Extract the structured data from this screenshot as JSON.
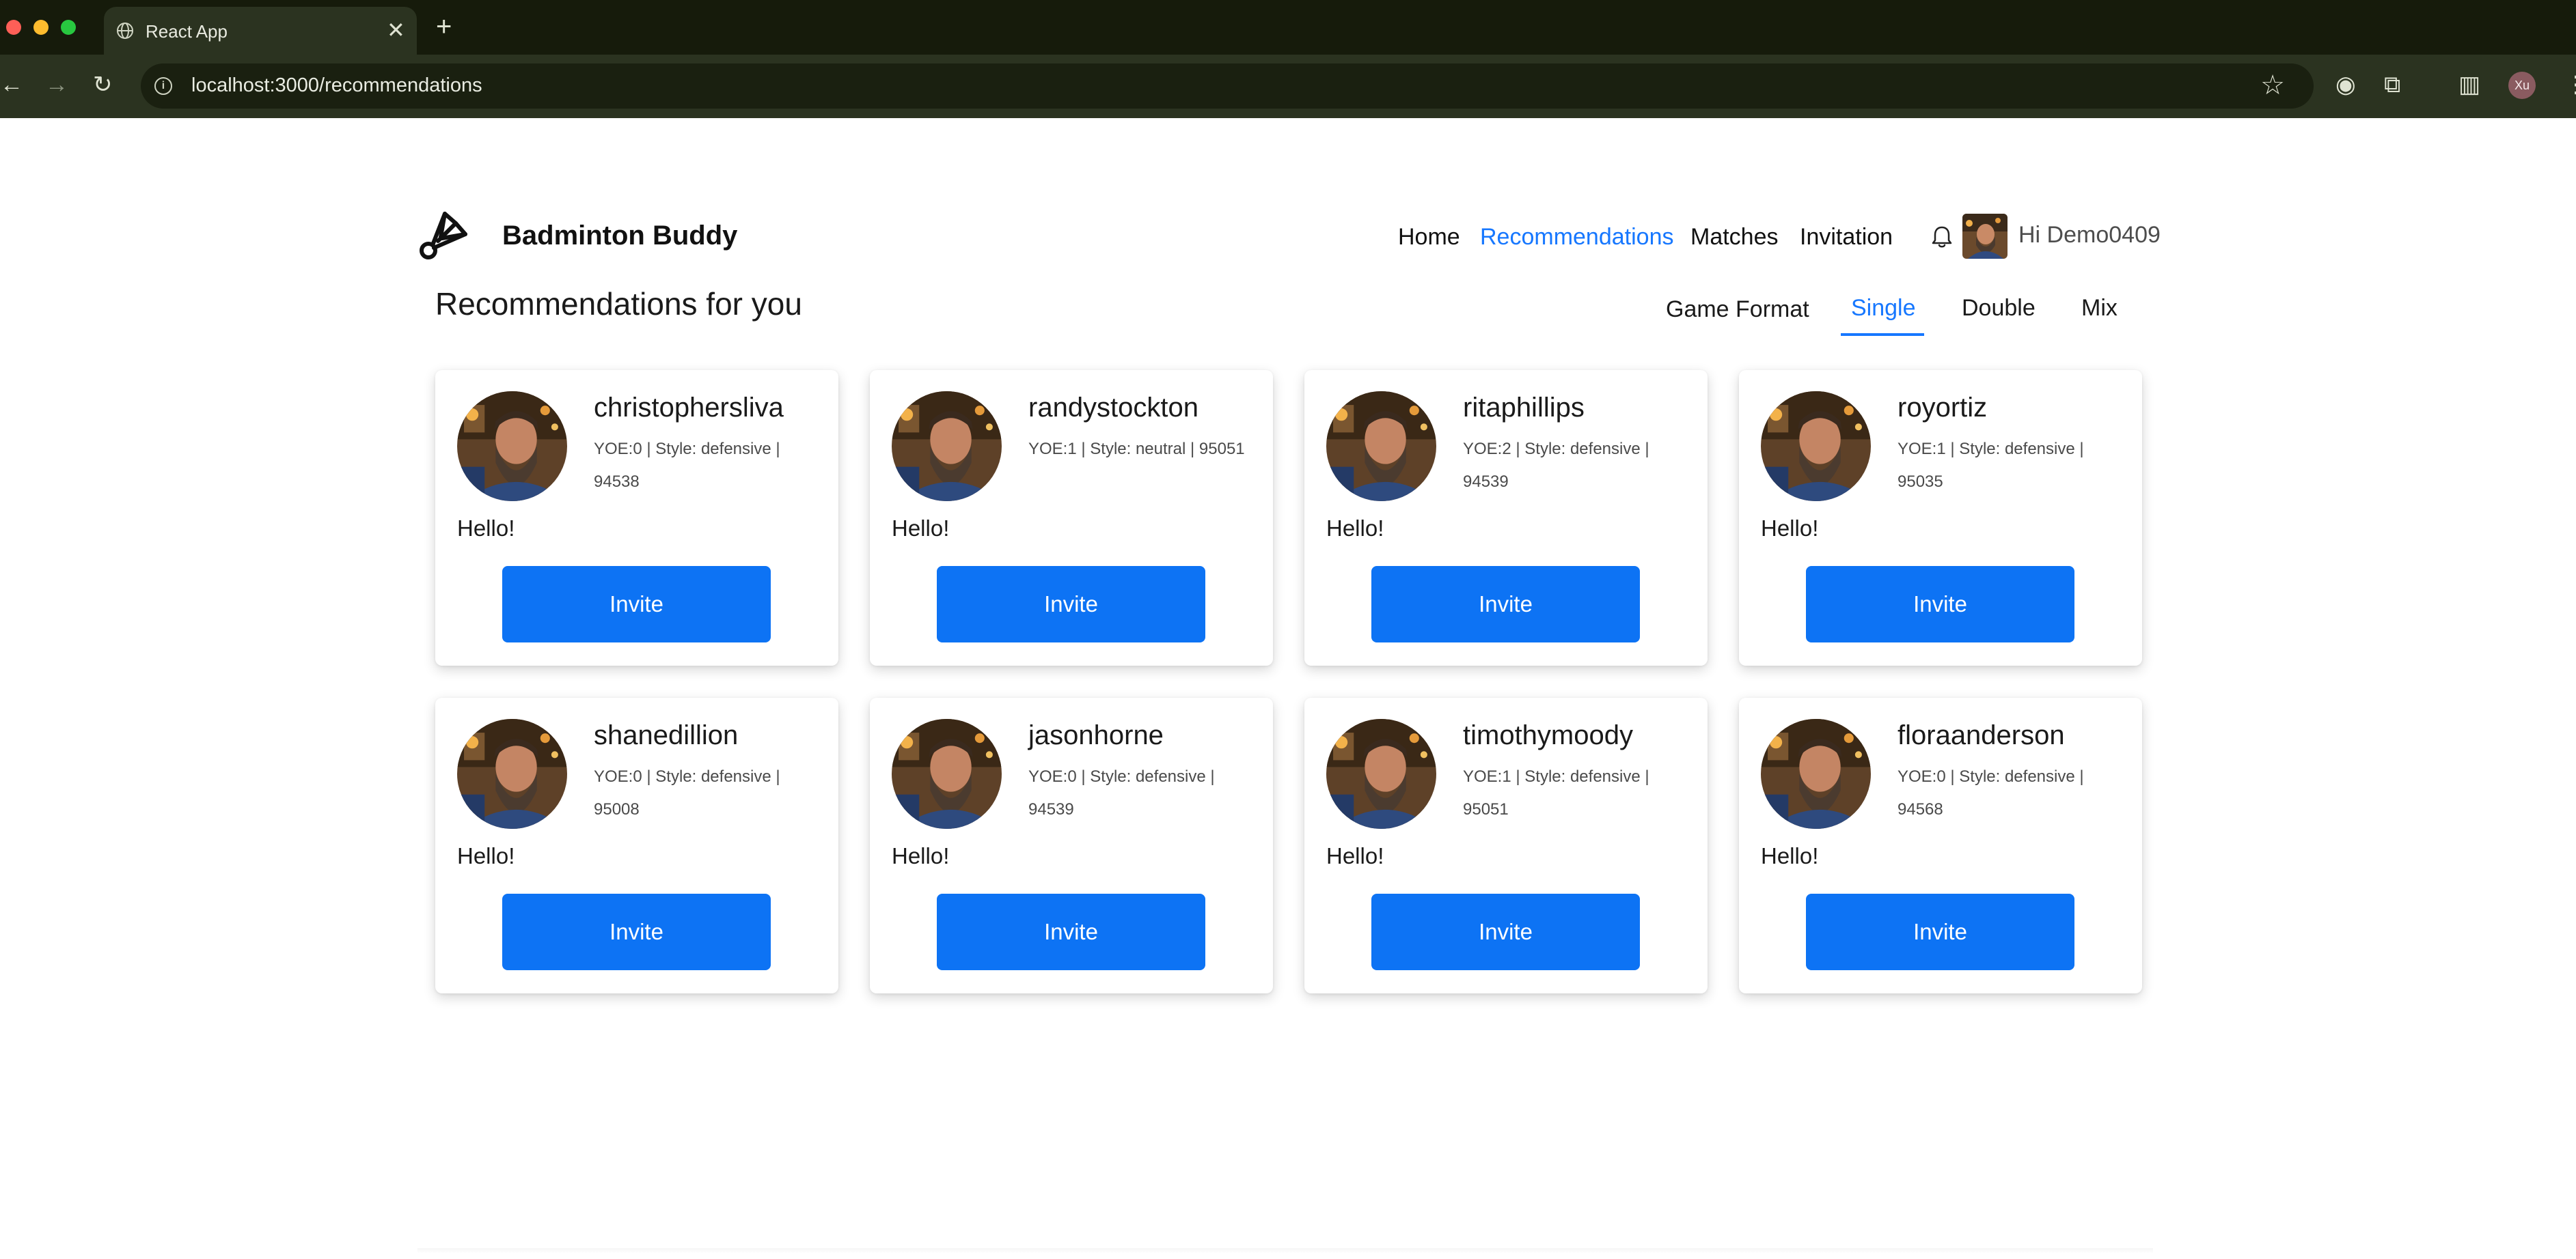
{
  "browser": {
    "tab_title": "React App",
    "tab_close": "✕",
    "new_tab": "+",
    "url": "localhost:3000/recommendations",
    "profile_initials": "Xu"
  },
  "header": {
    "brand": "Badminton Buddy",
    "nav": {
      "home": "Home",
      "recommendations": "Recommendations",
      "matches": "Matches",
      "invitation": "Invitation"
    },
    "greeting": "Hi Demo0409"
  },
  "page": {
    "title": "Recommendations for you",
    "format_label": "Game Format",
    "format_tabs": [
      "Single",
      "Double",
      "Mix"
    ],
    "active_format": "Single"
  },
  "cards": [
    {
      "name": "christophersliva",
      "meta": "YOE:0 | Style: defensive | 94538",
      "message": "Hello!",
      "button": "Invite"
    },
    {
      "name": "randystockton",
      "meta": "YOE:1 | Style: neutral | 95051",
      "message": "Hello!",
      "button": "Invite"
    },
    {
      "name": "ritaphillips",
      "meta": "YOE:2 | Style: defensive | 94539",
      "message": "Hello!",
      "button": "Invite"
    },
    {
      "name": "royortiz",
      "meta": "YOE:1 | Style: defensive | 95035",
      "message": "Hello!",
      "button": "Invite"
    },
    {
      "name": "shanedillion",
      "meta": "YOE:0 | Style: defensive | 95008",
      "message": "Hello!",
      "button": "Invite"
    },
    {
      "name": "jasonhorne",
      "meta": "YOE:0 | Style: defensive | 94539",
      "message": "Hello!",
      "button": "Invite"
    },
    {
      "name": "timothymoody",
      "meta": "YOE:1 | Style: defensive | 95051",
      "message": "Hello!",
      "button": "Invite"
    },
    {
      "name": "floraanderson",
      "meta": "YOE:0 | Style: defensive | 94568",
      "message": "Hello!",
      "button": "Invite"
    }
  ],
  "icons": {
    "logo": "shuttlecock-icon",
    "bell": "bell-icon",
    "avatar": "user-photo"
  },
  "colors": {
    "accent": "#1677ff",
    "button": "#0d73f4",
    "chrome": "#2b3320"
  }
}
